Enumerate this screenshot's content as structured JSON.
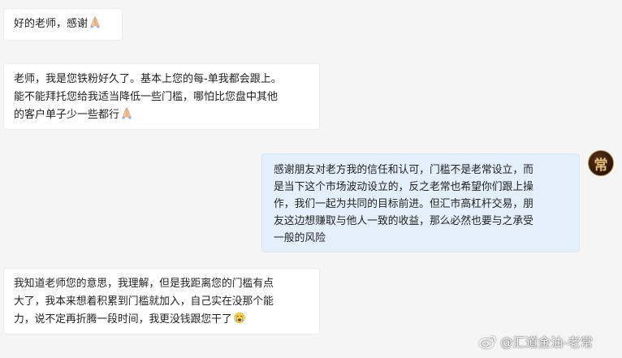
{
  "messages": [
    {
      "side": "incoming",
      "lines": [
        "好的老师，感谢"
      ],
      "trailing_emoji": "folded-hands-icon"
    },
    {
      "side": "incoming",
      "lines": [
        "老师，我是您铁粉好久了。基本上您的每-单我都会跟上。",
        "能不能拜托您给我适当降低一些门槛，哪怕比您盘中其他",
        "的客户单子少一些都行"
      ],
      "trailing_emoji": "folded-hands-icon"
    },
    {
      "side": "outgoing",
      "lines": [
        "感谢朋友对老方我的信任和认可，门槛不是老常设立，而",
        "是当下这个市场波动设立的，反之老常也希望你们跟上操",
        "作，我们一起为共同的目标前进。但汇市高杠杆交易，朋",
        "友这边想赚取与他人一致的收益，那么必然也要与之承受",
        "一般的风险"
      ]
    },
    {
      "side": "incoming",
      "lines": [
        "我知道老师您的意思，我理解，但是我距离您的门槛有点",
        "大了，我本来想着积累到门槛就加入，自己实在没那个能",
        "力，说不定再折腾一段时间，我更没钱跟您干了"
      ],
      "trailing_emoji": "crying-face-icon"
    }
  ],
  "avatar": {
    "char": "常"
  },
  "watermark": {
    "text": "@汇道金油-老常",
    "icon": "weibo-icon"
  },
  "colors": {
    "background": "#f5f5f5",
    "incoming_bubble": "#ffffff",
    "outgoing_bubble": "#e3f0fc",
    "text": "#222222"
  }
}
